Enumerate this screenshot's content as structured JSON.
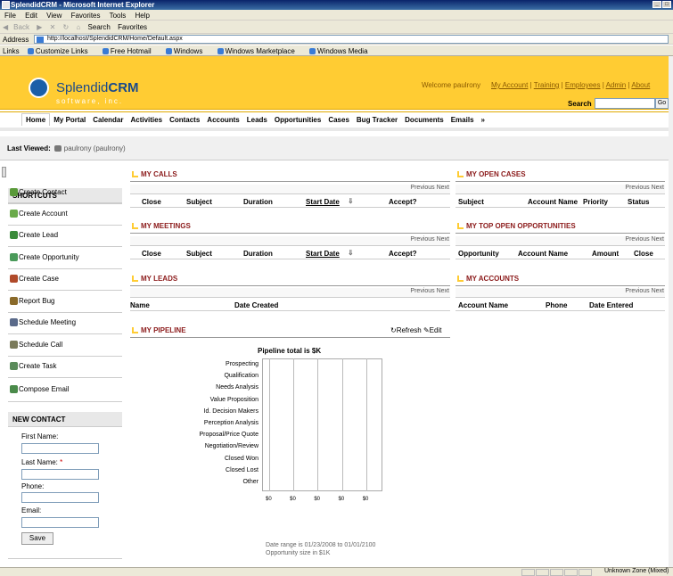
{
  "window": {
    "title": "SplendidCRM - Microsoft Internet Explorer"
  },
  "menu": [
    "File",
    "Edit",
    "View",
    "Favorites",
    "Tools",
    "Help"
  ],
  "toolbar": {
    "back": "Back",
    "search": "Search",
    "favorites": "Favorites"
  },
  "address": {
    "label": "Address",
    "url": "http://localhost/SplendidCRM/Home/Default.aspx"
  },
  "links": {
    "label": "Links",
    "items": [
      "Customize Links",
      "Free Hotmail",
      "Windows",
      "Windows Marketplace",
      "Windows Media"
    ]
  },
  "brand": {
    "name_prefix": "Splendid",
    "name_bold": "CRM",
    "tagline": "software, inc."
  },
  "header": {
    "welcome": "Welcome paulrony",
    "links": [
      "My Account",
      "Training",
      "Employees",
      "Admin",
      "About"
    ],
    "search_label": "Search",
    "go": "Go"
  },
  "nav": [
    "Home",
    "My Portal",
    "Calendar",
    "Activities",
    "Contacts",
    "Accounts",
    "Leads",
    "Opportunities",
    "Cases",
    "Bug Tracker",
    "Documents",
    "Emails",
    "»"
  ],
  "last_viewed": {
    "label": "Last Viewed:",
    "item": "paulrony (paulrony)"
  },
  "shortcuts": {
    "title": "SHORTCUTS",
    "items": [
      {
        "label": "Create Contact",
        "icon": "contact-icon",
        "color": "#5a9a3a"
      },
      {
        "label": "Create Account",
        "icon": "account-icon",
        "color": "#6aaa4a"
      },
      {
        "label": "Create Lead",
        "icon": "lead-icon",
        "color": "#3a8a3a"
      },
      {
        "label": "Create Opportunity",
        "icon": "opportunity-icon",
        "color": "#4a9a5a"
      },
      {
        "label": "Create Case",
        "icon": "case-icon",
        "color": "#b04a2a"
      },
      {
        "label": "Report Bug",
        "icon": "bug-icon",
        "color": "#8a6a2a"
      },
      {
        "label": "Schedule Meeting",
        "icon": "meeting-icon",
        "color": "#5a6a8a"
      },
      {
        "label": "Schedule Call",
        "icon": "call-icon",
        "color": "#7a7a5a"
      },
      {
        "label": "Create Task",
        "icon": "task-icon",
        "color": "#5a8a5a"
      },
      {
        "label": "Compose Email",
        "icon": "email-icon",
        "color": "#4a8a4a"
      }
    ]
  },
  "new_contact": {
    "title": "NEW CONTACT",
    "first_name": "First Name:",
    "last_name": "Last Name:",
    "required": "*",
    "phone": "Phone:",
    "email": "Email:",
    "save": "Save"
  },
  "pager": {
    "text": "Previous Next"
  },
  "panels": {
    "calls": {
      "title": "MY CALLS",
      "cols": [
        "Close",
        "Subject",
        "Duration",
        "Start Date",
        "Accept?"
      ]
    },
    "meetings": {
      "title": "MY MEETINGS",
      "cols": [
        "Close",
        "Subject",
        "Duration",
        "Start Date",
        "Accept?"
      ]
    },
    "leads": {
      "title": "MY LEADS",
      "cols": [
        "Name",
        "Date Created"
      ]
    },
    "pipeline": {
      "title": "MY PIPELINE",
      "refresh": "Refresh",
      "edit": "Edit"
    },
    "open_cases": {
      "title": "MY OPEN CASES",
      "cols": [
        "Subject",
        "Account Name",
        "Priority",
        "Status"
      ]
    },
    "top_opps": {
      "title": "MY TOP OPEN OPPORTUNITIES",
      "cols": [
        "Opportunity",
        "Account Name",
        "Amount",
        "Close"
      ]
    },
    "accounts": {
      "title": "MY ACCOUNTS",
      "cols": [
        "Account Name",
        "Phone",
        "Date Entered"
      ]
    }
  },
  "chart_data": {
    "type": "bar",
    "title": "Pipeline total is $K",
    "categories": [
      "Prospecting",
      "Qualification",
      "Needs Analysis",
      "Value Proposition",
      "Id. Decision Makers",
      "Perception Analysis",
      "Proposal/Price Quote",
      "Negotiation/Review",
      "Closed Won",
      "Closed Lost",
      "Other"
    ],
    "values": [
      0,
      0,
      0,
      0,
      0,
      0,
      0,
      0,
      0,
      0,
      0
    ],
    "x_ticks": [
      "$0",
      "$0",
      "$0",
      "$0",
      "$0"
    ],
    "notes": [
      "Date range is 01/23/2008 to 01/01/2100",
      "Opportunity size in $1K"
    ]
  },
  "status": {
    "zone": "Unknown Zone (Mixed)"
  }
}
